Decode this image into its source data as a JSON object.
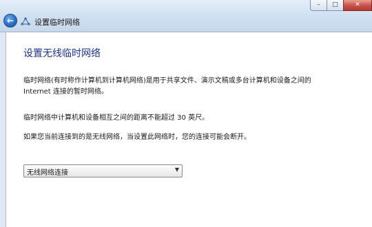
{
  "window": {
    "title": "设置临时网络",
    "minimize_glyph": "–",
    "maximize_glyph": "□",
    "close_glyph": "✕"
  },
  "nav": {
    "back_icon": "back-arrow-icon",
    "back_glyph": "←"
  },
  "main": {
    "heading": "设置无线临时网络",
    "paragraph1": "临时网络(有时称作计算机到计算机网络)是用于共享文件、演示文稿或多台计算机和设备之间的 Internet 连接的暂时网络。",
    "paragraph2": "临时网络中计算机和设备相互之间的距离不能超过 30 英尺。",
    "paragraph3": "如果您当前连接到的是无线网络，当设置此网络时，您的连接可能会断开。"
  },
  "connection_select": {
    "selected_value": "无线网络连接",
    "arrow_glyph": "▼"
  },
  "colors": {
    "heading": "#1e3287",
    "titlebar": "#cfdff0",
    "close_button": "#c75050"
  }
}
